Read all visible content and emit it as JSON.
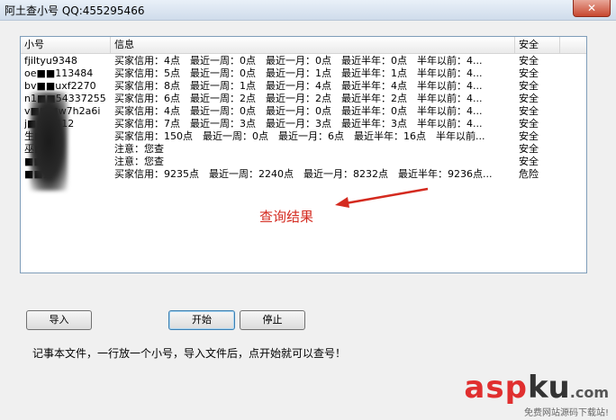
{
  "window": {
    "title": "阿土查小号 QQ:455295466",
    "close_label": "✕"
  },
  "list": {
    "columns": [
      "小号",
      "信息",
      "安全"
    ],
    "rows": [
      {
        "account": "fjiltyu9348",
        "info": "买家信用：4点　最近一周：0点　最近一月：0点　最近半年：0点　半年以前：4...",
        "status": "安全"
      },
      {
        "account": "oe■■113484",
        "info": "买家信用：5点　最近一周：0点　最近一月：1点　最近半年：1点　半年以前：4...",
        "status": "安全"
      },
      {
        "account": "bv■■uxf2270",
        "info": "买家信用：8点　最近一周：1点　最近一月：4点　最近半年：4点　半年以前：4...",
        "status": "安全"
      },
      {
        "account": "n1■■54337255",
        "info": "买家信用：6点　最近一周：2点　最近一月：2点　最近半年：2点　半年以前：4...",
        "status": "安全"
      },
      {
        "account": "v■■■w7h2a6i",
        "info": "买家信用：4点　最近一周：0点　最近一月：0点　最近半年：0点　半年以前：4...",
        "status": "安全"
      },
      {
        "account": "j■■■412",
        "info": "买家信用：7点　最近一周：3点　最近一月：3点　最近半年：3点　半年以前：4...",
        "status": "安全"
      },
      {
        "account": "生■■",
        "info": "买家信用：150点　最近一周：0点　最近一月：6点　最近半年：16点　半年以前...",
        "status": "安全"
      },
      {
        "account": "巫■■",
        "info": "注意：您查",
        "status": "安全"
      },
      {
        "account": "■■4",
        "info": "注意：您查",
        "status": "安全"
      },
      {
        "account": "■■宣",
        "info": "买家信用：9235点　最近一周：2240点　最近一月：8232点　最近半年：9236点...",
        "status": "危险"
      }
    ]
  },
  "annotation": "查询结果",
  "buttons": {
    "import": "导入",
    "start": "开始",
    "stop": "停止"
  },
  "hint": "记事本文件，一行放一个小号，导入文件后，点开始就可以查号！",
  "watermark": {
    "asp": "asp",
    "ku": "ku",
    "com": ".com",
    "sub": "免费网站源码下载站!"
  }
}
